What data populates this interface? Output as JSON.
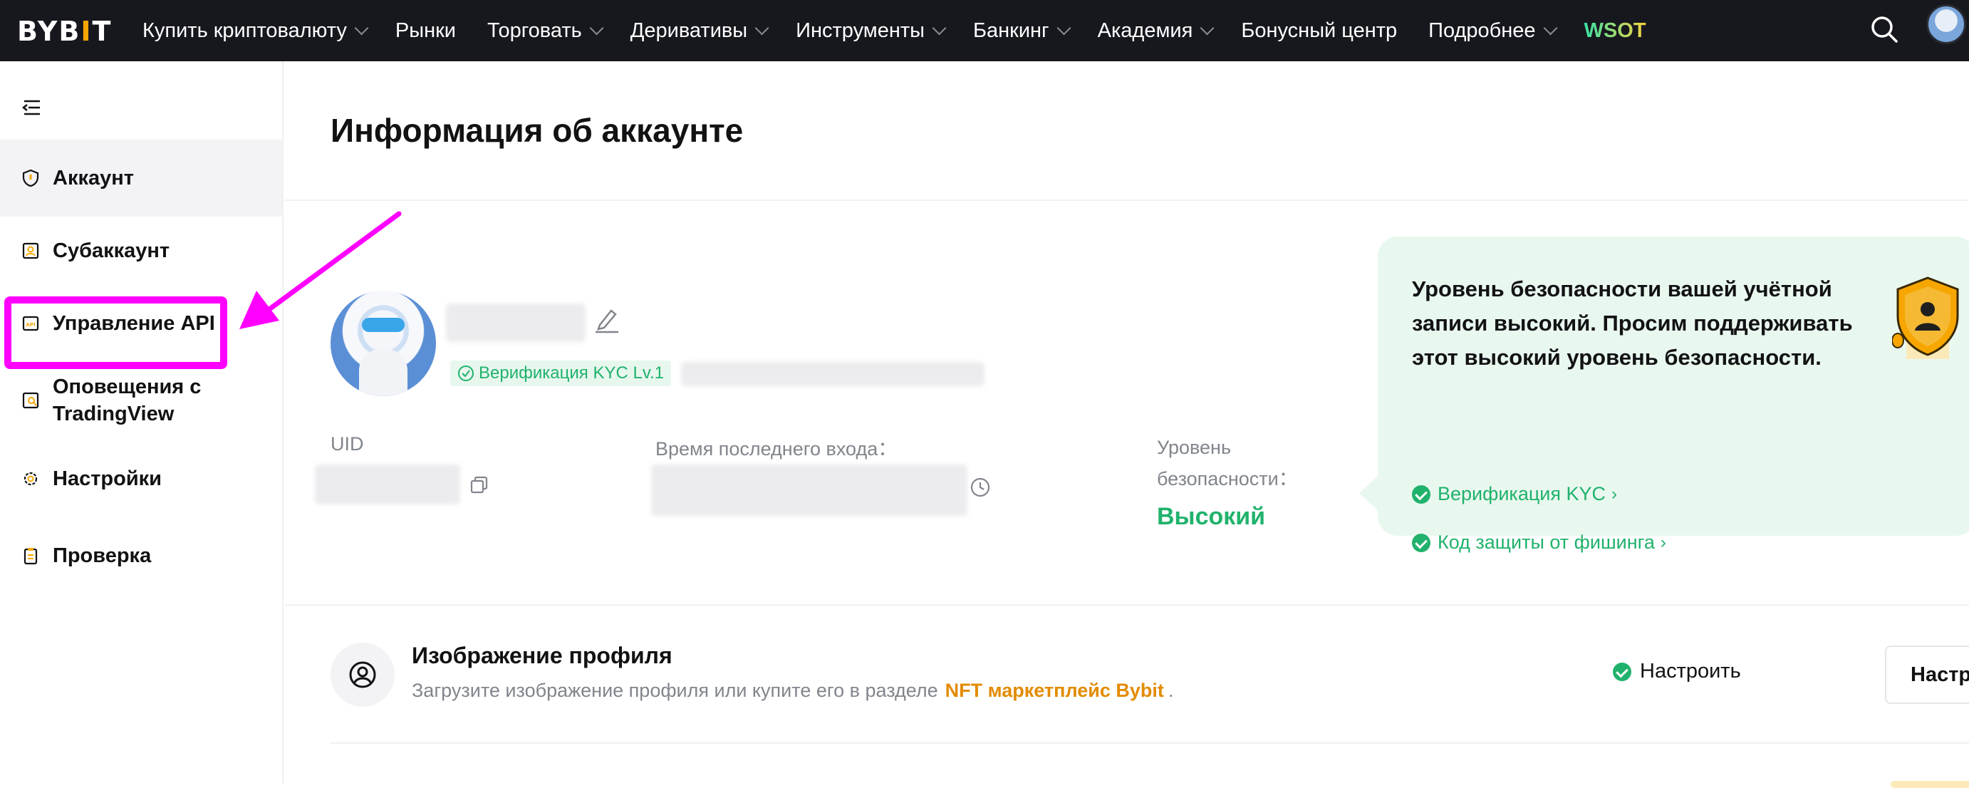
{
  "header": {
    "logo_text": "BYBIT",
    "nav": [
      {
        "label": "Купить криптовалюту",
        "dropdown": true
      },
      {
        "label": "Рынки",
        "dropdown": false
      },
      {
        "label": "Торговать",
        "dropdown": true
      },
      {
        "label": "Деривативы",
        "dropdown": true
      },
      {
        "label": "Инструменты",
        "dropdown": true
      },
      {
        "label": "Банкинг",
        "dropdown": true
      },
      {
        "label": "Академия",
        "dropdown": true
      },
      {
        "label": "Бонусный центр",
        "dropdown": false
      },
      {
        "label": "Подробнее",
        "dropdown": true
      },
      {
        "label": "WSOT",
        "dropdown": false
      }
    ]
  },
  "sidebar": {
    "items": [
      {
        "label": "Аккаунт",
        "icon": "shield-icon",
        "active": true
      },
      {
        "label": "Субаккаунт",
        "icon": "subaccount-icon",
        "active": false
      },
      {
        "label": "Управление API",
        "icon": "api-icon",
        "active": false
      },
      {
        "label": "Оповещения с TradingView",
        "icon": "tradingview-icon",
        "active": false
      },
      {
        "label": "Настройки",
        "icon": "gear-icon",
        "active": false
      },
      {
        "label": "Проверка",
        "icon": "clipboard-icon",
        "active": false
      }
    ]
  },
  "main": {
    "title": "Информация об аккаунте",
    "kyc_badge": "Верификация KYC Lv.1",
    "uid_label": "UID",
    "last_login_label": "Время последнего входа：",
    "security_label": "Уровень безопасности：",
    "security_value": "Высокий",
    "security_card": {
      "text": "Уровень безопасности вашей учётной записи высокий. Просим поддерживать этот высокий уровень безопасности.",
      "links": [
        "Верификация KYC",
        "Код защиты от фишинга"
      ]
    },
    "profile_row": {
      "title": "Изображение профиля",
      "desc_prefix": "Загрузите изображение профиля или купите его в разделе",
      "desc_link": "NFT маркетплейс Bybit",
      "desc_suffix": ".",
      "status": "Настроить",
      "button": "Настроить"
    }
  },
  "colors": {
    "accent_green": "#20b26c",
    "highlight": "#ff00ff",
    "nft_link": "#e38b00"
  }
}
